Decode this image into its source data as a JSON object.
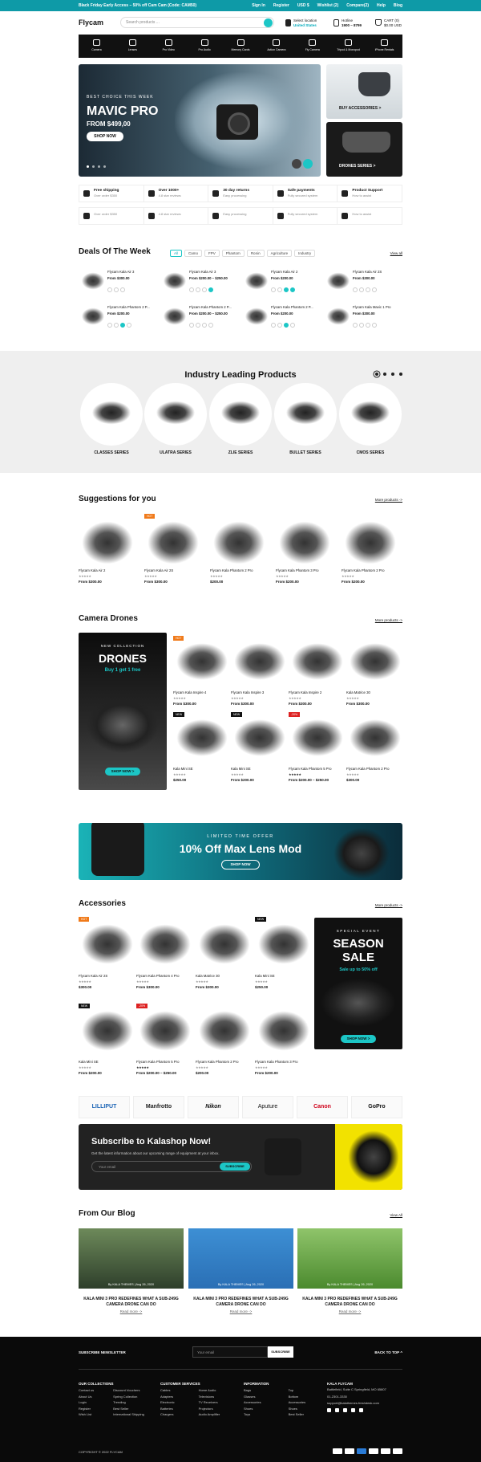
{
  "topbar": {
    "promo": "Black Friday Early Access – 50% off Cam Cam (Code: CAM50)",
    "links": [
      "Sign In",
      "Register",
      "USD $",
      "Wishlist (2)",
      "Compare(2)",
      "Help",
      "Blog"
    ]
  },
  "header": {
    "logo": "Flycam",
    "search_placeholder": "Search products ...",
    "location_label": "Select location",
    "location_value": "United States",
    "hotline_label": "Hotline",
    "hotline_value": "1900 – 8799",
    "cart_label": "CART (0)",
    "cart_total": "$0.00 USD"
  },
  "categories": [
    "Camera",
    "Lenses",
    "Pro Video",
    "Pro Audio",
    "Memory Cards",
    "Action Camera",
    "Fly Camera",
    "Tripod & Monopod",
    "iPhone Rentals"
  ],
  "hero": {
    "eyebrow": "BEST CHOICE THIS WEEK",
    "title": "MAVIC PRO",
    "price": "FROM $499,00",
    "cta": "SHOP NOW",
    "side1": "BUY ACCESSORIES >",
    "side2": "DRONES SERIES >"
  },
  "features": [
    {
      "title": "Free shipping",
      "sub": "Over order $350"
    },
    {
      "title": "Over 1000+",
      "sub": "4.8 star reviews"
    },
    {
      "title": "30 day returns",
      "sub": "Easy processing"
    },
    {
      "title": "Safe payments",
      "sub": "Fully secured system"
    },
    {
      "title": "Product Support",
      "sub": "How to assist"
    }
  ],
  "features2": [
    {
      "title": "",
      "sub": "Over order $350"
    },
    {
      "title": "",
      "sub": "4.8 star reviews"
    },
    {
      "title": "",
      "sub": "Easy processing"
    },
    {
      "title": "",
      "sub": "Fully secured system"
    },
    {
      "title": "",
      "sub": "How to assist"
    }
  ],
  "deals": {
    "title": "Deals Of The Week",
    "view_all": "View all",
    "tabs": [
      "All",
      "Camo",
      "FPV",
      "Phantom",
      "Ronin",
      "Agriculture",
      "Industry"
    ],
    "items": [
      {
        "name": "Flycam Kala Air 3",
        "price": "$300.00"
      },
      {
        "name": "Flycam Kala Air 3",
        "price": "$200.00 – $250.00"
      },
      {
        "name": "Flycam Kala Air 2",
        "price": "$200.00"
      },
      {
        "name": "Flycam Kala Air 2S",
        "price": "$300.00"
      },
      {
        "name": "Flycam Kala Phantom 2 P...",
        "price": "$200.00"
      },
      {
        "name": "Flycam Kala Phantom 2 P...",
        "price": "$200.00 – $250.00"
      },
      {
        "name": "Flycam Kala Phantom 2 P...",
        "price": "$200.00"
      },
      {
        "name": "Flycam Kala Mavic 1 Pro",
        "price": "$300.00"
      }
    ]
  },
  "industry": {
    "title": "Industry Leading Products",
    "series": [
      "CLASSES SERIES",
      "ULATRA SERIES",
      "ZLIE SERIES",
      "BULLET SERIES",
      "CMOS SERIES"
    ]
  },
  "suggestions": {
    "title": "Suggestions for you",
    "more": "More products ->",
    "items": [
      {
        "name": "Flycam Kala Air 2",
        "price": "$300.00"
      },
      {
        "name": "Flycam Kala Air 2S",
        "price": "$300.00"
      },
      {
        "name": "Flycam Kala Phantom 2 Pro",
        "price": "$200.00"
      },
      {
        "name": "Flycam Kala Phantom 3 Pro",
        "price": "$200.00"
      },
      {
        "name": "Flycam Kala Phantom 2 Pro",
        "price": "$200.00"
      }
    ]
  },
  "camera": {
    "title": "Camera Drones",
    "more": "More products ->",
    "banner": {
      "eyebrow": "NEW COLLECTION",
      "title": "DRONES",
      "sub": "Buy 1 get 1 free",
      "cta": "SHOP NOW >"
    },
    "items": [
      {
        "name": "Flycam Kala Inspire 4",
        "price": "$300.00"
      },
      {
        "name": "Flycam Kala Inspire 3",
        "price": "$300.00"
      },
      {
        "name": "Flycam Kala Inspire 2",
        "price": "$300.00"
      },
      {
        "name": "Kala Matrice 30",
        "price": "$300.00"
      },
      {
        "name": "Kala Mini SE",
        "price": "$250.00"
      },
      {
        "name": "Kala Mini SE",
        "price": "$200.00"
      },
      {
        "name": "Flycam Kala Phantom 5 Pro",
        "price": "$200.00 – $250.00"
      },
      {
        "name": "Flycam Kala Phantom 2 Pro",
        "price": "$300.00"
      }
    ]
  },
  "promo": {
    "eyebrow": "LIMITED TIME OFFER",
    "title": "10% Off Max Lens Mod",
    "cta": "SHOP NOW"
  },
  "accessories": {
    "title": "Accessories",
    "more": "More products ->",
    "banner": {
      "eyebrow": "SPECIAL EVENT",
      "title": "SEASON SALE",
      "sub": "Sale up to 50% off",
      "cta": "SHOP NOW >"
    },
    "items": [
      {
        "name": "Flycam Kala Air 2S",
        "price": "$300.00"
      },
      {
        "name": "Flycam Kala Phantom 4 Pro",
        "price": "$300.00"
      },
      {
        "name": "Kala Matrice 30",
        "price": "$300.00"
      },
      {
        "name": "Kala Mini SE",
        "price": "$250.00"
      },
      {
        "name": "Kala Mini SE",
        "price": "$200.00"
      },
      {
        "name": "Flycam Kala Phantom 5 Pro",
        "price": "$200.00 – $250.00"
      },
      {
        "name": "Flycam Kala Phantom 2 Pro",
        "price": "$200.00"
      },
      {
        "name": "Flycam Kala Phantom 3 Pro",
        "price": "$200.00"
      }
    ]
  },
  "brands": [
    "LILLIPUT",
    "Manfrotto",
    "Nikon",
    "Aputure",
    "Canon",
    "GoPro"
  ],
  "subscribe": {
    "title": "Subscribe to Kalashop Now!",
    "sub": "Get the latest information about our upcoming range of equipment at your inbox.",
    "placeholder": "Your email",
    "cta": "SUBSCRIBE"
  },
  "blog": {
    "title": "From Our Blog",
    "view_all": "View All",
    "posts": [
      {
        "by": "By KALA THEMES | Aug 26, 2020",
        "title": "KALA MINI 3 PRO REDEFINES WHAT A SUB-249G CAMERA DRONE CAN DO",
        "more": "Read more ->"
      },
      {
        "by": "By KALA THEMES | Aug 26, 2020",
        "title": "KALA MINI 3 PRO REDEFINES WHAT A SUB-249G CAMERA DRONE CAN DO",
        "more": "Read more ->"
      },
      {
        "by": "By KALA THEMES | Aug 26, 2020",
        "title": "KALA MINI 3 PRO REDEFINES WHAT A SUB-249G CAMERA DRONE CAN DO",
        "more": "Read more ->"
      }
    ]
  },
  "footer": {
    "newsletter": "SUBSCRIBE NEWSLETTER",
    "email_placeholder": "Your email",
    "subscribe": "SUBSCRIBE",
    "back_to_top": "BACK TO TOP",
    "cols": [
      {
        "title": "OUR COLLECTIONS",
        "a": [
          "Contact us",
          "About Us",
          "Login",
          "Register",
          "Wish List"
        ],
        "b": [
          "Discount Vouchers",
          "Spring Collection",
          "Trending",
          "Best Seller",
          "International Shipping"
        ]
      },
      {
        "title": "CUSTOMER SERVICES",
        "a": [
          "Cables",
          "Adapters",
          "Electronic",
          "Batteries",
          "Chargers"
        ],
        "b": [
          "Home Audio",
          "Televisions",
          "TV Receivers",
          "Projectors",
          "Audio Amplifier"
        ]
      },
      {
        "title": "INFORMATION",
        "a": [
          "Bags",
          "Glasses",
          "Accessories",
          "Shoes",
          "Toys"
        ],
        "b": [
          "Top",
          "Bottom",
          "Accessories",
          "Shoes",
          "Best Seller"
        ]
      }
    ],
    "contact": {
      "title": "KALA FLYCAM",
      "address": "Battlefield, Suite C Springfield, MO 65807",
      "phone": "01-2301-3330",
      "email": "support@kalathemes.freshdesk.com"
    },
    "copyright": "COPYRIGHT © 2022 FLYCAM"
  }
}
